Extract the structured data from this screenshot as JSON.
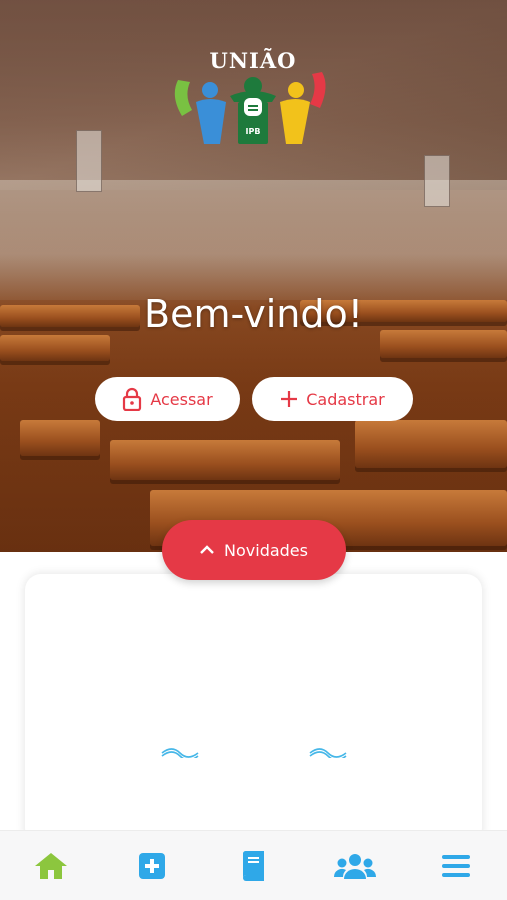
{
  "logo": {
    "title": "UNIÃO",
    "badge": "IPB"
  },
  "hero": {
    "welcome": "Bem-vindo!"
  },
  "actions": {
    "access_label": "Acessar",
    "register_label": "Cadastrar"
  },
  "news": {
    "label": "Novidades"
  },
  "tabbar": {
    "items": [
      {
        "icon": "home-icon",
        "active": true
      },
      {
        "icon": "plus-square-icon",
        "active": false
      },
      {
        "icon": "book-icon",
        "active": false
      },
      {
        "icon": "users-icon",
        "active": false
      },
      {
        "icon": "menu-icon",
        "active": false
      }
    ]
  },
  "colors": {
    "accent": "#e53946",
    "tab_active": "#8cc63e",
    "tab_inactive": "#2fa8e8",
    "loader": "#46b7e8"
  }
}
